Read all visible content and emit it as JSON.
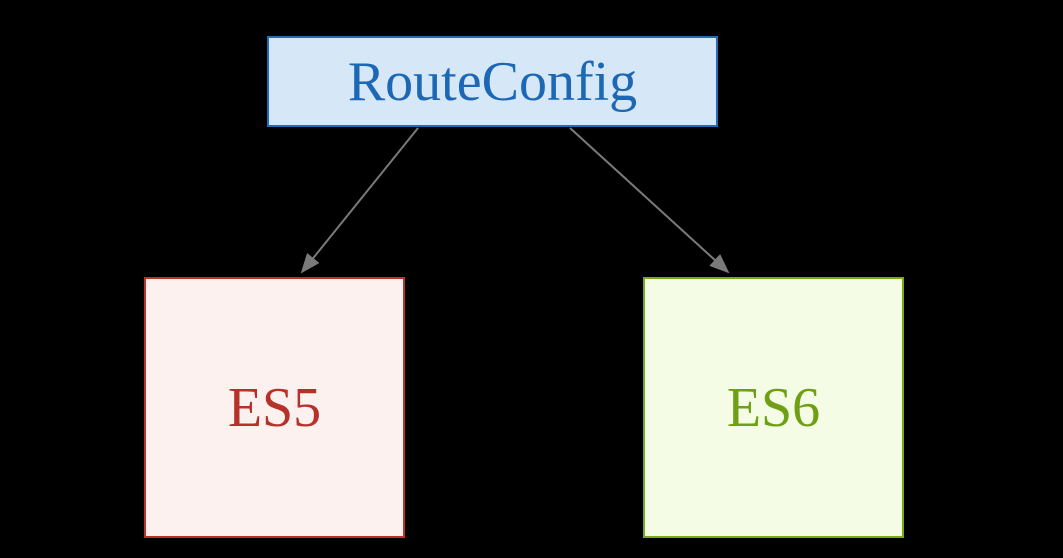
{
  "diagram": {
    "parent": {
      "label": "RouteConfig",
      "fill": "#d6e7f7",
      "border": "#1f6cb8",
      "textColor": "#1d68b4"
    },
    "children": [
      {
        "label": "ES5",
        "fill": "#fdf1f0",
        "border": "#b93128",
        "textColor": "#b6312a"
      },
      {
        "label": "ES6",
        "fill": "#f5fce6",
        "border": "#76a914",
        "textColor": "#6e9f14"
      }
    ],
    "arrowColor": "#7a7a7a"
  }
}
